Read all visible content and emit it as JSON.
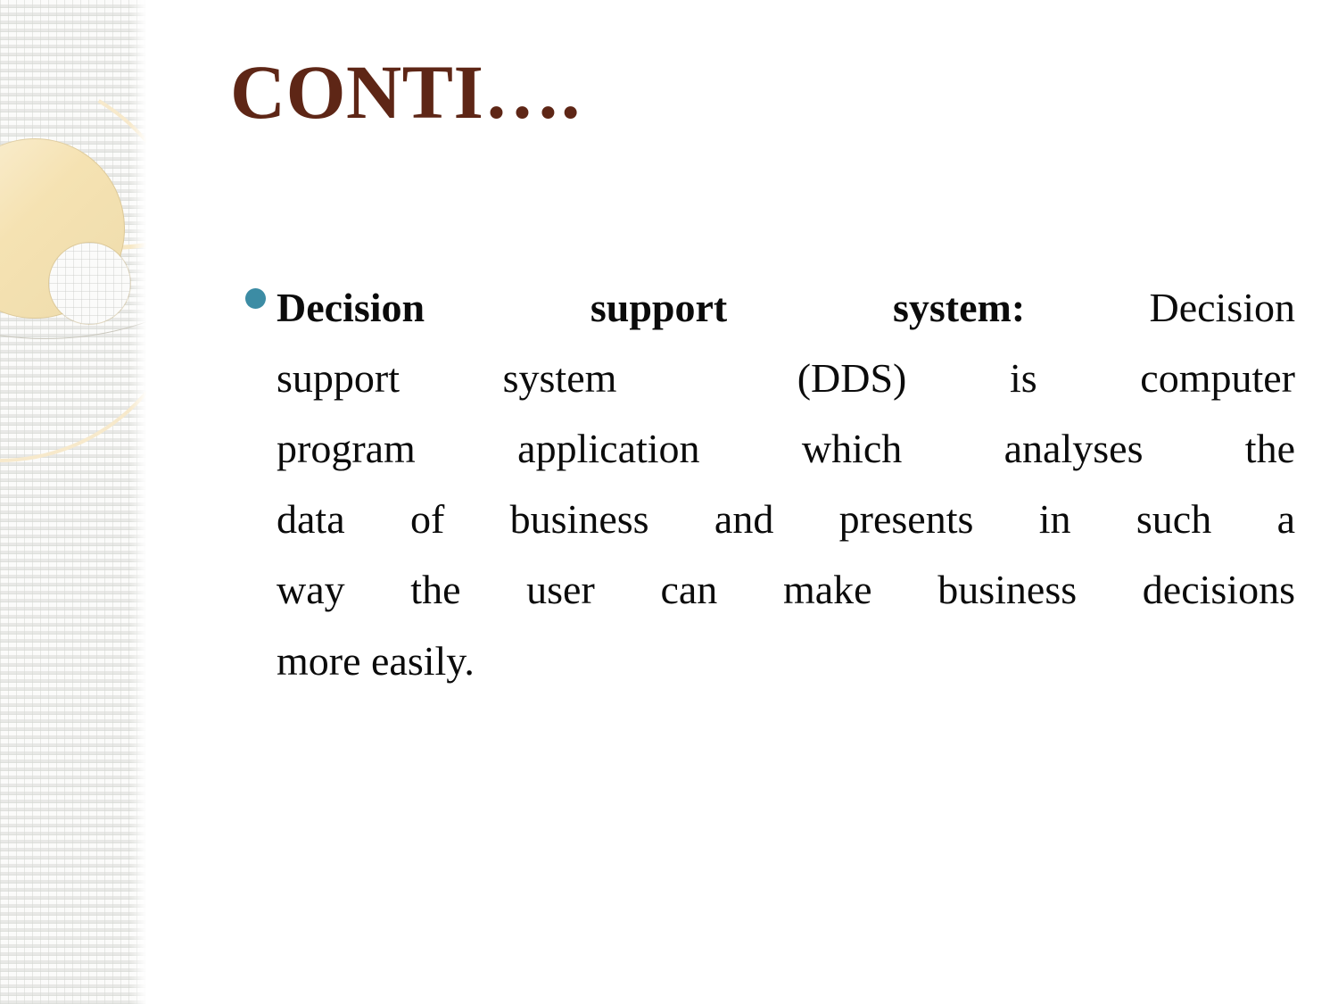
{
  "slide": {
    "title": "CONTI….",
    "title_color": "#5e2616",
    "background_color": "#ffffff",
    "bullet_color": "#3c8ca4",
    "body_text_color": "#0b0b0b",
    "decoration": {
      "band_color": "#fbfbfa",
      "ring_color": "#f5e2b2",
      "arc_cream_color": "#f6e7c4",
      "arc_gray_color": "#c9c7bd"
    }
  },
  "body": {
    "bullet_glyph": "bullet-dot",
    "lead_bold": "Decision support system:",
    "full_text": "Decision support system: Decision support system  (DDS) is computer program application which analyses the data of business and presents in such a way the user can make business decisions more easily.",
    "lines": [
      {
        "bold": "Decision    support    system:",
        "rest": "  Decision"
      },
      {
        "bold": "",
        "rest": "support   system      (DDS)   is   computer"
      },
      {
        "bold": "",
        "rest": "program  application  which  analyses  the"
      },
      {
        "bold": "",
        "rest": "data  of  business  and  presents  in  such  a"
      },
      {
        "bold": "",
        "rest": "way the user can make business decisions"
      },
      {
        "bold": "",
        "rest": "more easily."
      }
    ],
    "line_1_bold": "Decision    support    system:",
    "line_1_rest": "   Decision",
    "line_2": "support    system       (DDS)    is    computer",
    "line_3": "program   application   which   analyses   the",
    "line_4": "data  of  business  and  presents  in  such  a",
    "line_5": "way the user can make business decisions",
    "line_6": "more easily."
  }
}
